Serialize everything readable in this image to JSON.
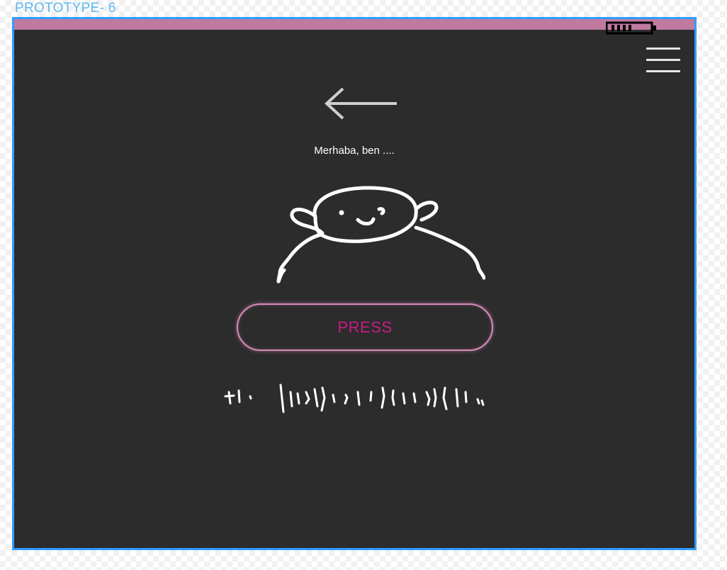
{
  "frame": {
    "label": "PROTOTYPE- 6"
  },
  "status_bar": {
    "color": "#c07aa0",
    "battery_icon": "battery-icon"
  },
  "header": {
    "menu_icon": "hamburger-menu-icon",
    "back_icon": "arrow-left-icon"
  },
  "main": {
    "greeting": "Merhaba, ben ....",
    "character_icon": "character-sketch",
    "press_button_label": "PRESS",
    "scribble_text": "handwritten-scribble"
  },
  "colors": {
    "background": "#2c2c2c",
    "frame_border": "#2f9dff",
    "button_text": "#c81d82",
    "button_border": "#d88ab9"
  }
}
